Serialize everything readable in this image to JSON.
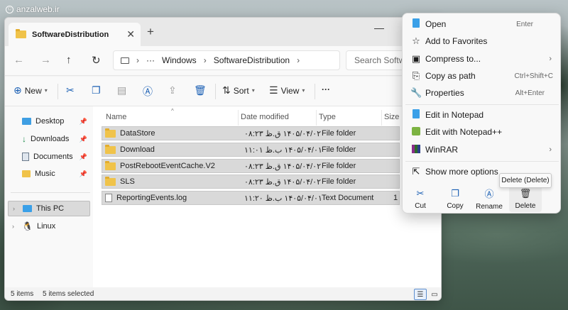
{
  "watermark": "anzalweb.ir",
  "window": {
    "tab_title": "SoftwareDistribution",
    "tab_close": "✕",
    "tab_add": "+",
    "minimize": "—"
  },
  "nav": {
    "back": "←",
    "forward": "→",
    "up": "↑",
    "refresh": "↻",
    "more_crumbs": "···",
    "breadcrumbs": [
      "Windows",
      "SoftwareDistribution"
    ],
    "search_placeholder": "Search Software"
  },
  "toolbar": {
    "new_label": "New",
    "sort_label": "Sort",
    "view_label": "View",
    "more": "···"
  },
  "sidebar": {
    "quick": [
      {
        "label": "Desktop"
      },
      {
        "label": "Downloads"
      },
      {
        "label": "Documents"
      },
      {
        "label": "Music"
      }
    ],
    "this_pc": "This PC",
    "linux": "Linux"
  },
  "columns": {
    "name": "Name",
    "date": "Date modified",
    "type": "Type",
    "size": "Size"
  },
  "rows": [
    {
      "name": "DataStore",
      "date": "۱۴۰۵/۰۴/۰۲ ق.ظ ۰۸:۲۳",
      "type": "File folder",
      "size": "",
      "icon": "folder"
    },
    {
      "name": "Download",
      "date": "۱۴۰۵/۰۴/۰۱ ب.ظ ۱۱:۰۱",
      "type": "File folder",
      "size": "",
      "icon": "folder"
    },
    {
      "name": "PostRebootEventCache.V2",
      "date": "۱۴۰۵/۰۴/۰۲ ق.ظ ۰۸:۲۳",
      "type": "File folder",
      "size": "",
      "icon": "folder"
    },
    {
      "name": "SLS",
      "date": "۱۴۰۵/۰۴/۰۲ ق.ظ ۰۸:۲۳",
      "type": "File folder",
      "size": "",
      "icon": "folder"
    },
    {
      "name": "ReportingEvents.log",
      "date": "۱۴۰۵/۰۴/۰۱ ب.ظ ۱۱:۲۰",
      "type": "Text Document",
      "size": "1",
      "icon": "file"
    }
  ],
  "status": {
    "items": "5 items",
    "selected": "5 items selected"
  },
  "context_menu": {
    "open": {
      "label": "Open",
      "shortcut": "Enter"
    },
    "favorites": {
      "label": "Add to Favorites"
    },
    "compress": {
      "label": "Compress to..."
    },
    "copy_path": {
      "label": "Copy as path",
      "shortcut": "Ctrl+Shift+C"
    },
    "properties": {
      "label": "Properties",
      "shortcut": "Alt+Enter"
    },
    "notepad": {
      "label": "Edit in Notepad"
    },
    "notepadpp": {
      "label": "Edit with Notepad++"
    },
    "winrar": {
      "label": "WinRAR"
    },
    "more_options": {
      "label": "Show more options"
    },
    "actions": [
      "Cut",
      "Copy",
      "Rename",
      "Delete"
    ],
    "tooltip": "Delete (Delete)"
  },
  "colors": {
    "accent": "#1a5fb4",
    "selection": "#d9d9d9",
    "folder": "#f0c34a"
  }
}
